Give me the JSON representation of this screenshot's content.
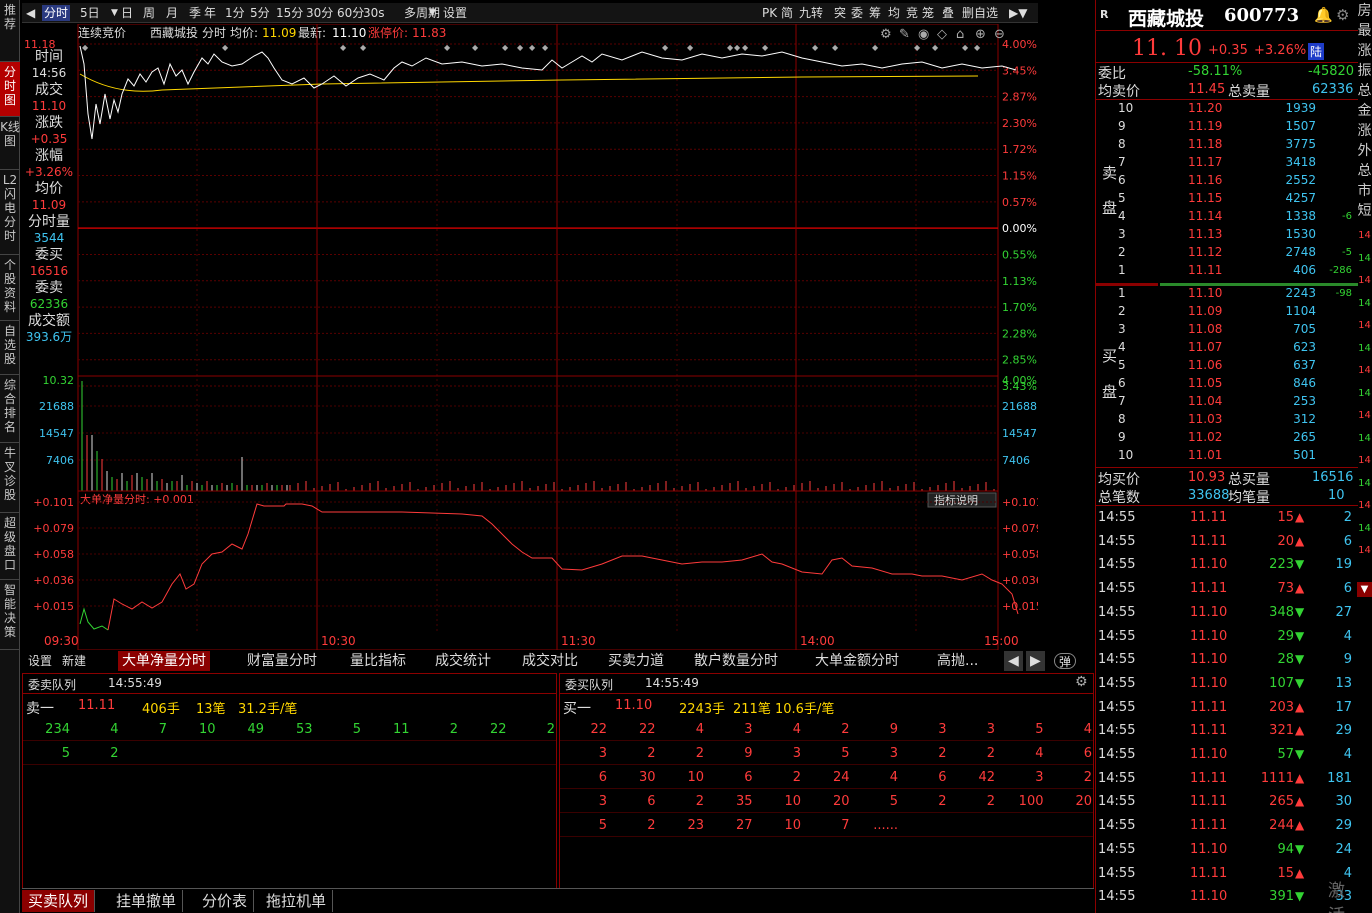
{
  "left_nav": [
    "推荐",
    "分时图",
    "K线图",
    "L2闪电分时",
    "个股资料",
    "自选股",
    "综合排名",
    "牛叉诊股",
    "超级盘口",
    "智能决策"
  ],
  "topbar": {
    "tabs": [
      "分时",
      "5日",
      "日",
      "周",
      "月",
      "季",
      "年",
      "1分",
      "5分",
      "15分",
      "30分",
      "60分",
      "30s",
      "多周期",
      "设置"
    ],
    "right": [
      "PK",
      "简",
      "九转",
      "突",
      "委",
      "筹",
      "均",
      "竞",
      "笼",
      "叠",
      "删自选"
    ]
  },
  "chart_header": {
    "auction": "连续竞价",
    "name": "西藏城投",
    "mode": "分时",
    "avg_label": "均价:",
    "avg": "11.09",
    "latest_label": "最新:",
    "latest": "11.10",
    "limit_label": "涨停价:",
    "limit": "11.83"
  },
  "price_axis": {
    "top": "11.18",
    "left_labels": [],
    "right_pct": [
      "4.00%",
      "3.45%",
      "2.87%",
      "2.30%",
      "1.72%",
      "1.15%",
      "0.57%",
      "0.00%",
      "0.55%",
      "1.13%",
      "1.70%",
      "2.28%",
      "2.85%",
      "3.43%"
    ]
  },
  "volume_axis": {
    "left": [
      "10.32",
      "21688",
      "14547",
      "7406"
    ],
    "right": [
      "4.00%",
      "21688",
      "14547",
      "7406"
    ]
  },
  "indicator": {
    "title": "大单净量分时: +0.001",
    "button": "指标说明",
    "axis": [
      "+0.101",
      "+0.079",
      "+0.058",
      "+0.036",
      "+0.015"
    ]
  },
  "time_axis": [
    "09:30",
    "10:30",
    "11:30",
    "14:00",
    "15:00"
  ],
  "info_box": [
    {
      "k": "时间",
      "v": "14:56",
      "c": "#ddd"
    },
    {
      "k": "成交",
      "v": "11.10",
      "c": "#ff3b3b"
    },
    {
      "k": "涨跌",
      "v": "+0.35",
      "c": "#ff3b3b"
    },
    {
      "k": "涨幅",
      "v": "+3.26%",
      "c": "#ff3b3b"
    },
    {
      "k": "均价",
      "v": "11.09",
      "c": "#ff3b3b"
    },
    {
      "k": "分时量",
      "v": "3544",
      "c": "#3fc4f0"
    },
    {
      "k": "委买",
      "v": "16516",
      "c": "#ff3b3b"
    },
    {
      "k": "委卖",
      "v": "62336",
      "c": "#33d433"
    },
    {
      "k": "成交额",
      "v": "393.6万",
      "c": "#3fc4f0"
    }
  ],
  "bottom_tabs": [
    "设置",
    "新建",
    "大单净量分时",
    "财富量分时",
    "量比指标",
    "成交统计",
    "成交对比",
    "买卖力道",
    "散户数量分时",
    "大单金额分时",
    "高抛..."
  ],
  "bottom_toggle": "弹",
  "sell_queue": {
    "title": "委卖队列",
    "time": "14:55:49",
    "level": "卖一",
    "price": "11.11",
    "hands": "406手",
    "orders": "13笔",
    "avg": "31.2手/笔",
    "rows": [
      [
        "234",
        "4",
        "7",
        "10",
        "49",
        "53",
        "5",
        "11",
        "2",
        "22",
        "2"
      ],
      [
        "5",
        "2"
      ]
    ]
  },
  "buy_queue": {
    "title": "委买队列",
    "time": "14:55:49",
    "level": "买一",
    "price": "11.10",
    "hands": "2243手",
    "orders": "211笔",
    "avg": "10.6手/笔",
    "rows": [
      [
        "22",
        "22",
        "4",
        "3",
        "4",
        "2",
        "9",
        "3",
        "3",
        "5",
        "4"
      ],
      [
        "3",
        "2",
        "2",
        "9",
        "3",
        "5",
        "3",
        "2",
        "2",
        "4",
        "6"
      ],
      [
        "6",
        "30",
        "10",
        "6",
        "2",
        "24",
        "4",
        "6",
        "42",
        "3",
        "2"
      ],
      [
        "3",
        "6",
        "2",
        "35",
        "10",
        "20",
        "5",
        "2",
        "2",
        "100",
        "20"
      ],
      [
        "5",
        "2",
        "23",
        "27",
        "10",
        "7",
        "......"
      ]
    ]
  },
  "footer_tabs": [
    "买卖队列",
    "挂单撤单",
    "分价表",
    "拖拉机单"
  ],
  "stock": {
    "badge": "R",
    "name": "西藏城投",
    "code": "600773",
    "price": "11. 10",
    "change": "+0.35",
    "pct": "+3.26%",
    "tag": "陆"
  },
  "ratio": {
    "label": "委比",
    "pct": "-58.11%",
    "val": "-45820"
  },
  "ask_summary": {
    "label1": "均卖价",
    "price": "11.45",
    "label2": "总卖量",
    "vol": "62336"
  },
  "sell_label": [
    "卖",
    "盘"
  ],
  "buy_label": [
    "买",
    "盘"
  ],
  "asks": [
    {
      "lv": "10",
      "p": "11.20",
      "v": "1939",
      "d": ""
    },
    {
      "lv": "9",
      "p": "11.19",
      "v": "1507",
      "d": ""
    },
    {
      "lv": "8",
      "p": "11.18",
      "v": "3775",
      "d": ""
    },
    {
      "lv": "7",
      "p": "11.17",
      "v": "3418",
      "d": ""
    },
    {
      "lv": "6",
      "p": "11.16",
      "v": "2552",
      "d": ""
    },
    {
      "lv": "5",
      "p": "11.15",
      "v": "4257",
      "d": ""
    },
    {
      "lv": "4",
      "p": "11.14",
      "v": "1338",
      "d": "-6"
    },
    {
      "lv": "3",
      "p": "11.13",
      "v": "1530",
      "d": ""
    },
    {
      "lv": "2",
      "p": "11.12",
      "v": "2748",
      "d": "-5"
    },
    {
      "lv": "1",
      "p": "11.11",
      "v": "406",
      "d": "-286"
    }
  ],
  "bids": [
    {
      "lv": "1",
      "p": "11.10",
      "v": "2243",
      "d": "-98"
    },
    {
      "lv": "2",
      "p": "11.09",
      "v": "1104",
      "d": ""
    },
    {
      "lv": "3",
      "p": "11.08",
      "v": "705",
      "d": ""
    },
    {
      "lv": "4",
      "p": "11.07",
      "v": "623",
      "d": ""
    },
    {
      "lv": "5",
      "p": "11.06",
      "v": "637",
      "d": ""
    },
    {
      "lv": "6",
      "p": "11.05",
      "v": "846",
      "d": ""
    },
    {
      "lv": "7",
      "p": "11.04",
      "v": "253",
      "d": ""
    },
    {
      "lv": "8",
      "p": "11.03",
      "v": "312",
      "d": ""
    },
    {
      "lv": "9",
      "p": "11.02",
      "v": "265",
      "d": ""
    },
    {
      "lv": "10",
      "p": "11.01",
      "v": "501",
      "d": ""
    }
  ],
  "bid_summary": {
    "label1": "均买价",
    "price": "10.93",
    "label2": "总买量",
    "vol": "16516"
  },
  "count_summary": {
    "label1": "总笔数",
    "count": "33688",
    "label2": "均笔量",
    "avg": "10"
  },
  "trades": [
    {
      "t": "14:55",
      "p": "11.11",
      "v": "15",
      "dir": "up",
      "n": "2"
    },
    {
      "t": "14:55",
      "p": "11.11",
      "v": "20",
      "dir": "up",
      "n": "6"
    },
    {
      "t": "14:55",
      "p": "11.10",
      "v": "223",
      "dir": "down",
      "n": "19"
    },
    {
      "t": "14:55",
      "p": "11.11",
      "v": "73",
      "dir": "up",
      "n": "6"
    },
    {
      "t": "14:55",
      "p": "11.10",
      "v": "348",
      "dir": "down",
      "n": "27"
    },
    {
      "t": "14:55",
      "p": "11.10",
      "v": "29",
      "dir": "down",
      "n": "4"
    },
    {
      "t": "14:55",
      "p": "11.10",
      "v": "28",
      "dir": "down",
      "n": "9"
    },
    {
      "t": "14:55",
      "p": "11.10",
      "v": "107",
      "dir": "down",
      "n": "13"
    },
    {
      "t": "14:55",
      "p": "11.11",
      "v": "203",
      "dir": "up",
      "n": "17"
    },
    {
      "t": "14:55",
      "p": "11.11",
      "v": "321",
      "dir": "up",
      "n": "29"
    },
    {
      "t": "14:55",
      "p": "11.10",
      "v": "57",
      "dir": "down",
      "n": "4"
    },
    {
      "t": "14:55",
      "p": "11.11",
      "v": "1111",
      "dir": "up",
      "n": "181"
    },
    {
      "t": "14:55",
      "p": "11.11",
      "v": "265",
      "dir": "up",
      "n": "30"
    },
    {
      "t": "14:55",
      "p": "11.11",
      "v": "244",
      "dir": "up",
      "n": "29"
    },
    {
      "t": "14:55",
      "p": "11.10",
      "v": "94",
      "dir": "down",
      "n": "24"
    },
    {
      "t": "14:55",
      "p": "11.11",
      "v": "15",
      "dir": "up",
      "n": "4"
    },
    {
      "t": "14:55",
      "p": "11.10",
      "v": "391",
      "dir": "down",
      "n": "33"
    }
  ],
  "right_edge": [
    "房",
    "最",
    "涨",
    "振",
    "总",
    "金",
    "涨",
    "外",
    "总",
    "市",
    "短"
  ],
  "right_edge_nums": [
    "14",
    "14",
    "14",
    "14",
    "14",
    "14",
    "14",
    "14",
    "14",
    "14",
    "14",
    "14",
    "14",
    "14",
    "14"
  ],
  "watermark": "激活"
}
